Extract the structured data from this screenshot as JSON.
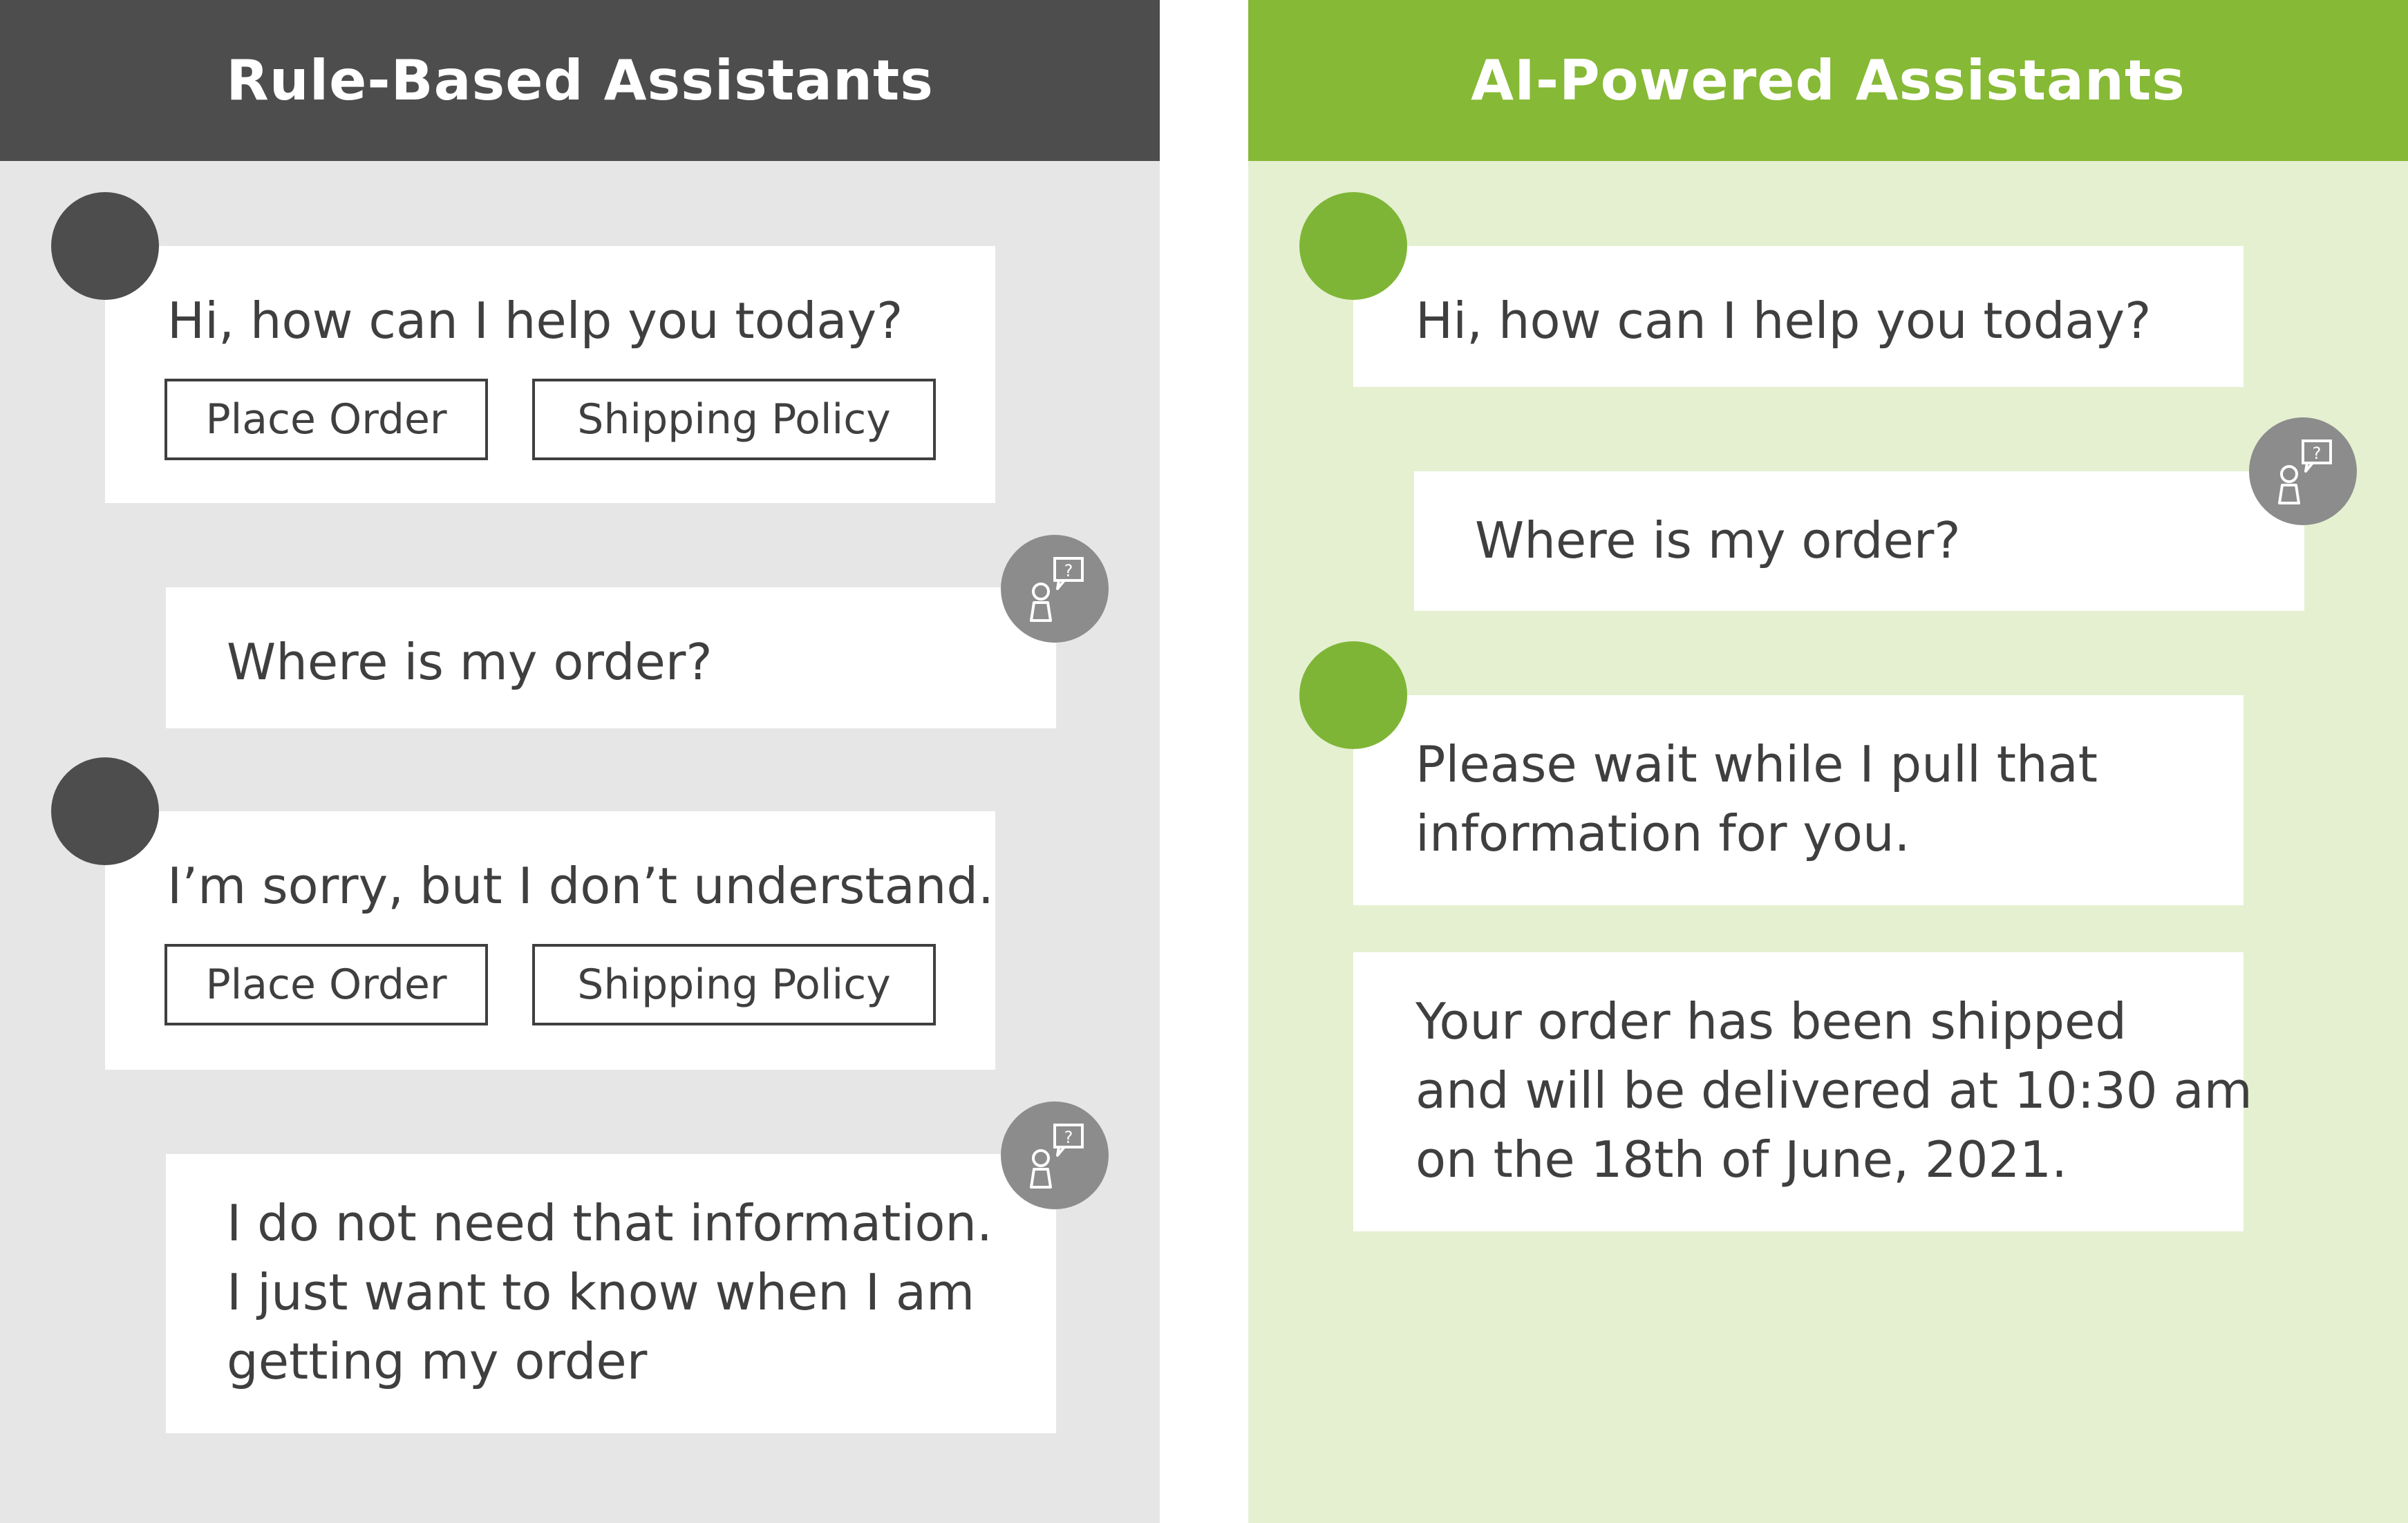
{
  "left_panel": {
    "title": "Rule-Based Assistants",
    "messages": [
      {
        "text": "Hi, how can I help you today?",
        "options": [
          "Place Order",
          "Shipping Policy"
        ]
      },
      {
        "text": "Where is my order?"
      },
      {
        "text": "I’m sorry, but I don’t understand.",
        "options": [
          "Place Order",
          "Shipping Policy"
        ]
      },
      {
        "lines": [
          "I do not need that information.",
          "I just want to know when I am",
          "getting my order"
        ]
      }
    ]
  },
  "right_panel": {
    "title": "AI-Powered Assistants",
    "messages": [
      {
        "text": "Hi, how can I help you today?"
      },
      {
        "text": "Where is my order?"
      },
      {
        "lines": [
          "Please wait while I pull that",
          "information for you."
        ]
      },
      {
        "lines": [
          "Your order has been shipped",
          "and will be delivered at 10:30 am",
          "on the 18th of June, 2021."
        ]
      }
    ]
  },
  "colors": {
    "left_header": "#4d4d4d",
    "left_background": "#e6e6e6",
    "right_header": "#86b935",
    "right_background": "#e5f0d1",
    "bot_avatar_left": "#4d4d4d",
    "bot_avatar_right": "#7fb536",
    "user_avatar": "#8c8c8c"
  },
  "icons": {
    "bot_avatar": "bot-avatar-icon",
    "user_avatar": "user-question-icon"
  }
}
